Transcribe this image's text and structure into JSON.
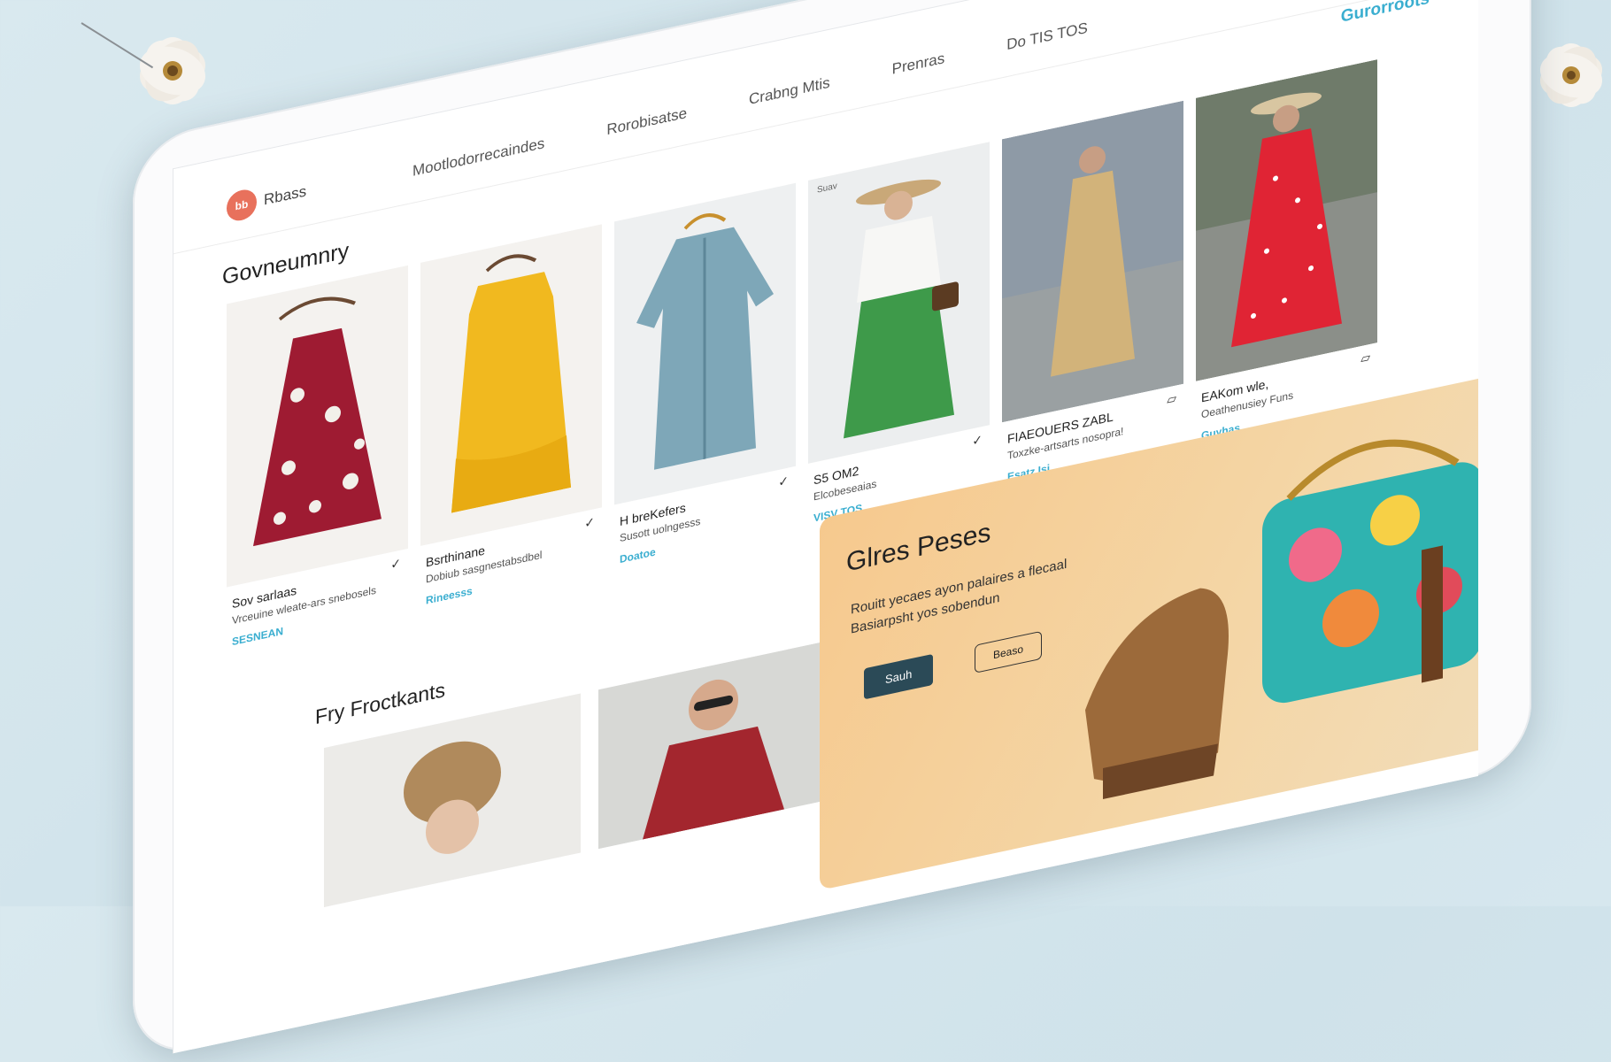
{
  "header": {
    "logo_mark": "bb",
    "logo_text": "Rbass",
    "nav": [
      "Mootlodorrecaindes",
      "Rorobisatse",
      "Crabng Mtis",
      "Prenras",
      "Do TIS TOS"
    ],
    "link": "Gurorroots",
    "icons": [
      "search-icon",
      "bag-icon",
      "user-icon",
      "more-icon"
    ]
  },
  "section_title": "Govneumnry",
  "products": [
    {
      "name": "Sov sarlaas",
      "desc": "Vrceuine wleate-ars snebosels",
      "link": "SESNEAN",
      "tag": ""
    },
    {
      "name": "Bsrthinane",
      "desc": "Dobiub sasgnestabsdbel",
      "link": "Rineesss",
      "tag": ""
    },
    {
      "name": "H breKefers",
      "desc": "Susott uolngesss",
      "link": "Doatoe",
      "tag": ""
    },
    {
      "name": "S5 OM2",
      "desc": "Elcobeseaias",
      "link": "VISV TOS",
      "tag": "Suav"
    },
    {
      "name": "FIAEOUERS ZABL",
      "desc": "Toxzke-artsarts nosopra!",
      "link": "Esatz Isi",
      "tag": ""
    },
    {
      "name": "EAKom wle,",
      "desc": "Oeathenusiey Funs",
      "link": "Guyhas",
      "tag": ""
    }
  ],
  "section2_title": "Fry Froctkants",
  "promo": {
    "title": "Glres Peses",
    "text": "Rouitt yecaes ayon palaires a flecaal Basiarpsht yos sobendun",
    "btn_primary": "Sauh",
    "btn_secondary": "Beaso"
  },
  "colors": {
    "accent": "#3aaed0",
    "logo": "#e8715c",
    "promo_btn": "#2b4a57",
    "promo_bg": "#f6c98e"
  }
}
